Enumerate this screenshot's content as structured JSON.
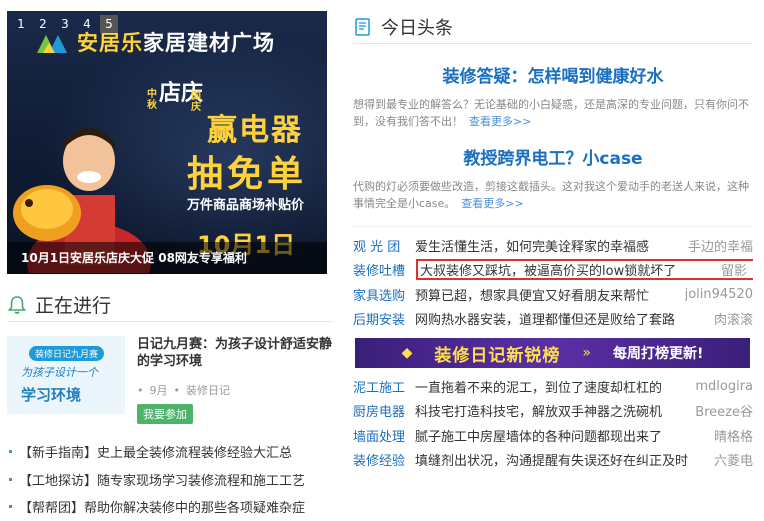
{
  "carousel": {
    "dots": [
      "1",
      "2",
      "3",
      "4",
      "5"
    ],
    "brand_name": "安居乐",
    "brand_rest": "家居建材广场",
    "promo_small": "中秋",
    "promo_store": "店庆",
    "promo_small2": "国庆",
    "promo_win": "赢电器",
    "promo_free": "抽免单",
    "promo_goods": "万件商品商场补贴价",
    "promo_date": "10月1日",
    "caption": "10月1日安居乐店庆大促 08网友专享福利"
  },
  "ongoing": {
    "title": "正在进行",
    "item": {
      "thumb_badge": "装修日记九月赛",
      "thumb_line1": "为孩子设计一个",
      "thumb_line2": "学习环境",
      "title": "日记九月赛：为孩子设计舒适安静的学习环境",
      "month": "9月",
      "tag": "装修日记",
      "join_label": "我要参加"
    },
    "guides": [
      "【新手指南】史上最全装修流程装修经验大汇总",
      "【工地探访】随专家现场学习装修流程和施工工艺",
      "【帮帮团】帮助你解决装修中的那些各项疑难杂症"
    ]
  },
  "headlines": {
    "title": "今日头条",
    "items": [
      {
        "title": "装修答疑：怎样喝到健康好水",
        "summary": "想得到最专业的解答么？无论基础的小白疑惑，还是高深的专业问题，只有你问不到，没有我们答不出！",
        "more": "查看更多>>"
      },
      {
        "title": "教授跨界电工？小case",
        "summary": "代购的灯必须要做些改造，剪接这截插头。这对我这个爱动手的老送人来说，这种事情完全是小case。",
        "more": "查看更多>>"
      }
    ],
    "feed_top": [
      {
        "cat": "观 光 团",
        "text": "爱生活懂生活，如何完美诠释家的幸福感",
        "author": "手边的幸福"
      },
      {
        "cat": "装修吐槽",
        "text": "大叔装修又踩坑，被逼高价买的low锁就坏了",
        "author": "留影",
        "highlight": true
      },
      {
        "cat": "家具选购",
        "text": "预算已超，想家具便宜又好看朋友来帮忙",
        "author": "jolin94520"
      },
      {
        "cat": "后期安装",
        "text": "网购热水器安装，道理都懂但还是败给了套路",
        "author": "肉滚滚"
      }
    ],
    "banner": {
      "left": "装修日记新锐榜",
      "right": "每周打榜更新!"
    },
    "feed_bottom": [
      {
        "cat": "泥工施工",
        "text": "一直拖着不来的泥工，到位了速度却杠杠的",
        "author": "mdlogira"
      },
      {
        "cat": "厨房电器",
        "text": "科技宅打造科技宅，解放双手神器之洗碗机",
        "author": "Breeze谷"
      },
      {
        "cat": "墙面处理",
        "text": "腻子施工中房屋墙体的各种问题都现出来了",
        "author": "晴格格"
      },
      {
        "cat": "装修经验",
        "text": "填缝剂出状况，沟通提醒有失误还好在纠正及时",
        "author": "六菱电"
      }
    ]
  },
  "colors": {
    "link_blue": "#1b6fc2",
    "green": "#40a86b",
    "highlight_red": "#e03131"
  }
}
